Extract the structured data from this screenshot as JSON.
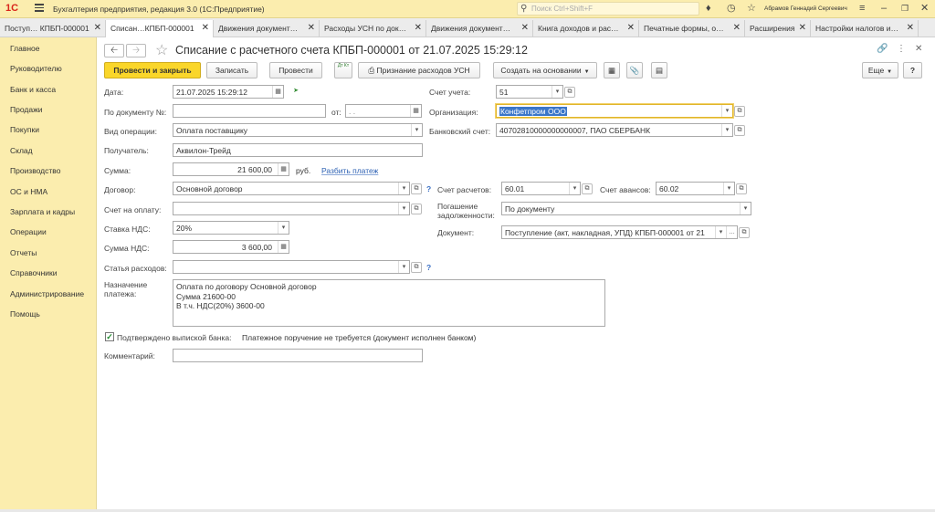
{
  "app": {
    "logo": "1С",
    "title": "Бухгалтерия предприятия, редакция 3.0  (1С:Предприятие)",
    "search_placeholder": "Поиск Ctrl+Shift+F",
    "user": "Абрамов Геннадий Сергеевич"
  },
  "tabs": [
    {
      "label": "Поступ… КПБП-000001"
    },
    {
      "label": "Списан…КПБП-000001"
    },
    {
      "label": "Движения документ…"
    },
    {
      "label": "Расходы УСН по док…"
    },
    {
      "label": "Движения документ…"
    },
    {
      "label": "Книга доходов и рас…"
    },
    {
      "label": "Печатные формы, о…"
    },
    {
      "label": "Расширения"
    },
    {
      "label": "Настройки налогов и…"
    }
  ],
  "sidebar": {
    "items": [
      {
        "label": "Главное"
      },
      {
        "label": "Руководителю"
      },
      {
        "label": "Банк и касса"
      },
      {
        "label": "Продажи"
      },
      {
        "label": "Покупки"
      },
      {
        "label": "Склад"
      },
      {
        "label": "Производство"
      },
      {
        "label": "ОС и НМА"
      },
      {
        "label": "Зарплата и кадры"
      },
      {
        "label": "Операции"
      },
      {
        "label": "Отчеты"
      },
      {
        "label": "Справочники"
      },
      {
        "label": "Администрирование"
      },
      {
        "label": "Помощь"
      }
    ]
  },
  "document": {
    "title": "Списание с расчетного счета КПБП-000001 от 21.07.2025 15:29:12"
  },
  "toolbar": {
    "post_close": "Провести и закрыть",
    "write": "Записать",
    "post": "Провести",
    "dt_kt": "Дт Кт",
    "usn": "Признание расходов УСН",
    "create_based": "Создать на основании",
    "more": "Еще",
    "help": "?"
  },
  "form": {
    "date_label": "Дата:",
    "date_value": "21.07.2025 15:29:12",
    "docnum_label": "По документу №:",
    "docnum_value": "",
    "from_label": "от:",
    "from_value": " .  .",
    "optype_label": "Вид операции:",
    "optype_value": "Оплата поставщику",
    "recipient_label": "Получатель:",
    "recipient_value": "Аквилон-Трейд",
    "sum_label": "Сумма:",
    "sum_value": "21 600,00",
    "currency": "руб.",
    "split_link": "Разбить платеж",
    "contract_label": "Договор:",
    "contract_value": "Основной договор",
    "invoice_label": "Счет на оплату:",
    "invoice_value": "",
    "vat_rate_label": "Ставка НДС:",
    "vat_rate_value": "20%",
    "vat_sum_label": "Сумма НДС:",
    "vat_sum_value": "3 600,00",
    "expense_label": "Статья расходов:",
    "expense_value": "",
    "purpose_label_1": "Назначение",
    "purpose_label_2": "платежа:",
    "purpose_lines": [
      "Оплата по договору Основной договор",
      "Сумма 21600-00",
      "В т.ч. НДС(20%) 3600-00"
    ],
    "confirmed_label": "Подтверждено выпиской банка:",
    "confirmed_text": "Платежное поручение не требуется (документ исполнен банком)",
    "comment_label": "Комментарий:",
    "comment_value": "",
    "account_label": "Счет учета:",
    "account_value": "51",
    "org_label": "Организация:",
    "org_value": "Конфетпром ООО",
    "bank_label": "Банковский счет:",
    "bank_value": "40702810000000000007, ПАО СБЕРБАНК",
    "settle_label": "Счет расчетов:",
    "settle_value": "60.01",
    "advance_label": "Счет авансов:",
    "advance_value": "60.02",
    "debt_label_1": "Погашение",
    "debt_label_2": "задолженности:",
    "debt_value": "По документу",
    "doc_label": "Документ:",
    "doc_value": "Поступление (акт, накладная, УПД) КПБП-000001 от 21"
  }
}
